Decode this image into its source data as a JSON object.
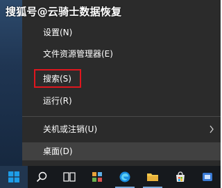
{
  "watermark": "搜狐号@云骑士数据恢复",
  "menu": {
    "items": [
      {
        "label": "设置(N)"
      },
      {
        "label": "文件资源管理器(E)"
      },
      {
        "label": "搜索(S)"
      },
      {
        "label": "运行(R)"
      },
      {
        "label": "关机或注销(U)"
      },
      {
        "label": "桌面(D)"
      }
    ],
    "submenu_icon": "chevron-right-icon"
  },
  "taskbar": {
    "icons": [
      "windows-start-icon",
      "search-icon",
      "task-view-icon",
      "app-icon",
      "edge-icon",
      "file-explorer-icon",
      "store-icon",
      "app-icon"
    ]
  },
  "colors": {
    "menu_bg": "#2b2b2b",
    "highlight_bg": "#414141",
    "annotation_box": "#e0161e",
    "taskbar_bg": "#16191d",
    "start_blue": "#1e9de8"
  }
}
